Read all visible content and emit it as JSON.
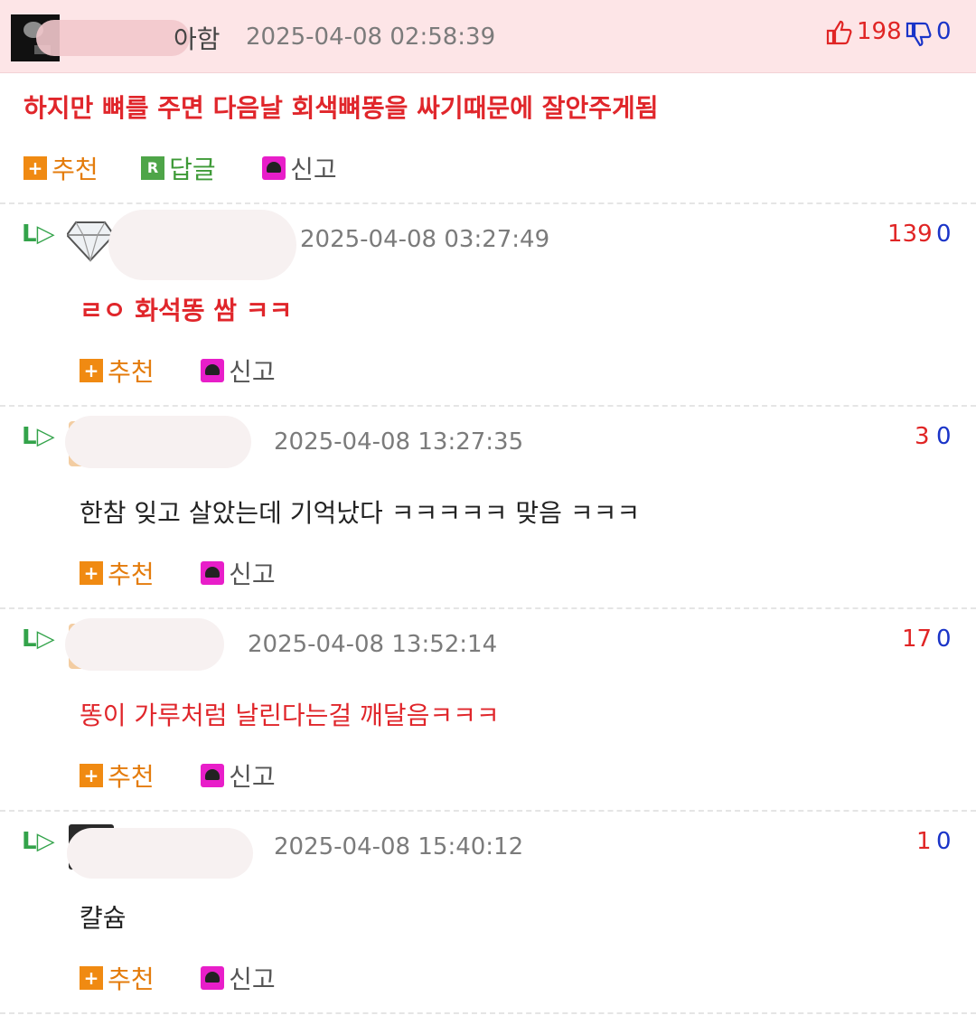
{
  "main_comment": {
    "nick_visible": "아함",
    "timestamp": "2025-04-08 02:58:39",
    "up_count": "198",
    "down_count": "0",
    "content": "하지만 뼈를 주면 다음날 회색뼈똥을 싸기때문에 잘안주게됨",
    "actions": {
      "recommend": "추천",
      "reply": "답글",
      "report": "신고",
      "reply_badge": "R"
    }
  },
  "replies": [
    {
      "arrow": "L▷",
      "nick_visible": "",
      "timestamp": "2025-04-08 03:27:49",
      "up": "139",
      "down": "0",
      "content": "ㄹㅇ 화석똥 쌈 ㅋㅋ",
      "recommend": "추천",
      "report": "신고"
    },
    {
      "arrow": "L▷",
      "nick_visible": "",
      "timestamp": "2025-04-08 13:27:35",
      "up": "3",
      "down": "0",
      "content": "한참 잊고 살았는데 기억났다 ㅋㅋㅋㅋㅋ 맞음 ㅋㅋㅋ",
      "recommend": "추천",
      "report": "신고"
    },
    {
      "arrow": "L▷",
      "nick_visible": "",
      "timestamp": "2025-04-08 13:52:14",
      "up": "17",
      "down": "0",
      "content": "똥이 가루처럼 날린다는걸 깨달음ㅋㅋㅋ",
      "recommend": "추천",
      "report": "신고"
    },
    {
      "arrow": "L▷",
      "nick_visible": "",
      "timestamp": "2025-04-08 15:40:12",
      "up": "1",
      "down": "0",
      "content": "캴슘",
      "recommend": "추천",
      "report": "신고"
    }
  ],
  "colors": {
    "header_bg": "#fde5e7",
    "upvote": "#e02525",
    "downvote": "#1a34c8",
    "accent_orange": "#f08a12",
    "reply_green": "#33a34a"
  },
  "icons": {
    "thumbs_up": "thumbs-up-icon",
    "thumbs_down": "thumbs-down-icon",
    "plus": "plus-icon",
    "reply": "reply-badge-icon",
    "report": "siren-icon",
    "reply_arrow": "reply-arrow-icon"
  }
}
